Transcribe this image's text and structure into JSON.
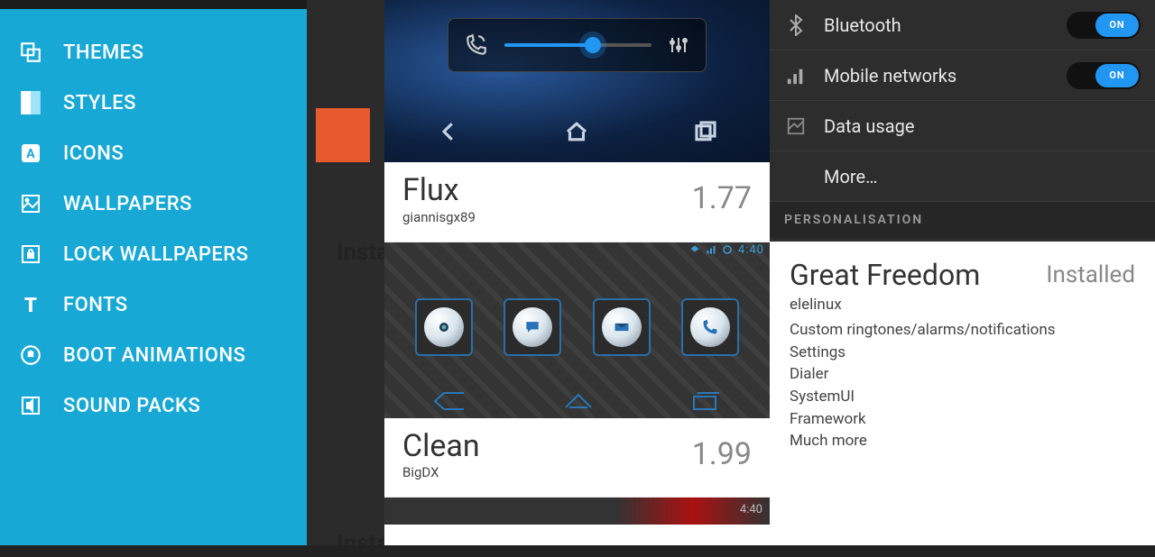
{
  "sidebar": {
    "items": [
      {
        "label": "THEMES",
        "icon": "themes-icon"
      },
      {
        "label": "STYLES",
        "icon": "styles-icon"
      },
      {
        "label": "ICONS",
        "icon": "icons-icon"
      },
      {
        "label": "WALLPAPERS",
        "icon": "wallpapers-icon"
      },
      {
        "label": "LOCK WALLPAPERS",
        "icon": "lock-wallpapers-icon"
      },
      {
        "label": "FONTS",
        "icon": "fonts-icon"
      },
      {
        "label": "BOOT ANIMATIONS",
        "icon": "boot-animations-icon"
      },
      {
        "label": "SOUND PACKS",
        "icon": "sound-packs-icon"
      }
    ]
  },
  "panel1_hint1": "Insta",
  "panel1_hint2": "Insta",
  "themes": [
    {
      "title": "Flux",
      "author": "giannisgx89",
      "price": "1.77"
    },
    {
      "title": "Clean",
      "author": "BigDX",
      "price": "1.99"
    }
  ],
  "panel2": {
    "status_time": "4:40",
    "bottom_time": "4:40"
  },
  "settings": {
    "rows": [
      {
        "label": "Bluetooth",
        "toggle": "ON"
      },
      {
        "label": "Mobile networks",
        "toggle": "ON"
      },
      {
        "label": "Data usage"
      },
      {
        "label": "More…"
      }
    ],
    "section": "PERSONALISATION"
  },
  "detail": {
    "title": "Great Freedom",
    "status": "Installed",
    "author": "elelinux",
    "lines": [
      "Custom ringtones/alarms/notifications",
      "Settings",
      "Dialer",
      "SystemUI",
      "Framework",
      "Much more"
    ]
  }
}
